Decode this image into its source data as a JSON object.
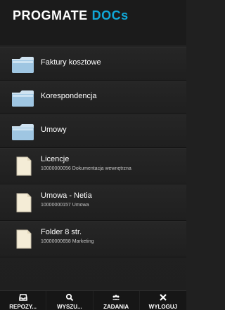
{
  "app": {
    "brand_main": "PROGMATE",
    "brand_accent": "DOCs"
  },
  "folders": [
    {
      "label": "Faktury kosztowe",
      "icon": "folder-icon"
    },
    {
      "label": "Korespondencja",
      "icon": "folder-icon"
    },
    {
      "label": "Umowy",
      "icon": "folder-icon"
    }
  ],
  "documents": [
    {
      "title": "Licencje",
      "meta": "10000000056 Dokumentacja wewnętrzna",
      "icon": "document-icon"
    },
    {
      "title": "Umowa - Netia",
      "meta": "10000000157 Umowa",
      "icon": "document-icon"
    },
    {
      "title": "Folder 8 str.",
      "meta": "10000000658 Marketing",
      "icon": "document-icon"
    }
  ],
  "bottom_nav": [
    {
      "label": "REPOZY...",
      "icon": "inbox-icon"
    },
    {
      "label": "WYSZU...",
      "icon": "search-icon"
    },
    {
      "label": "ZADANIA",
      "icon": "users-icon"
    },
    {
      "label": "WYLOGUJ",
      "icon": "close-icon"
    }
  ],
  "colors": {
    "accent": "#10a7d7",
    "background": "#202020",
    "text": "#ffffff"
  }
}
